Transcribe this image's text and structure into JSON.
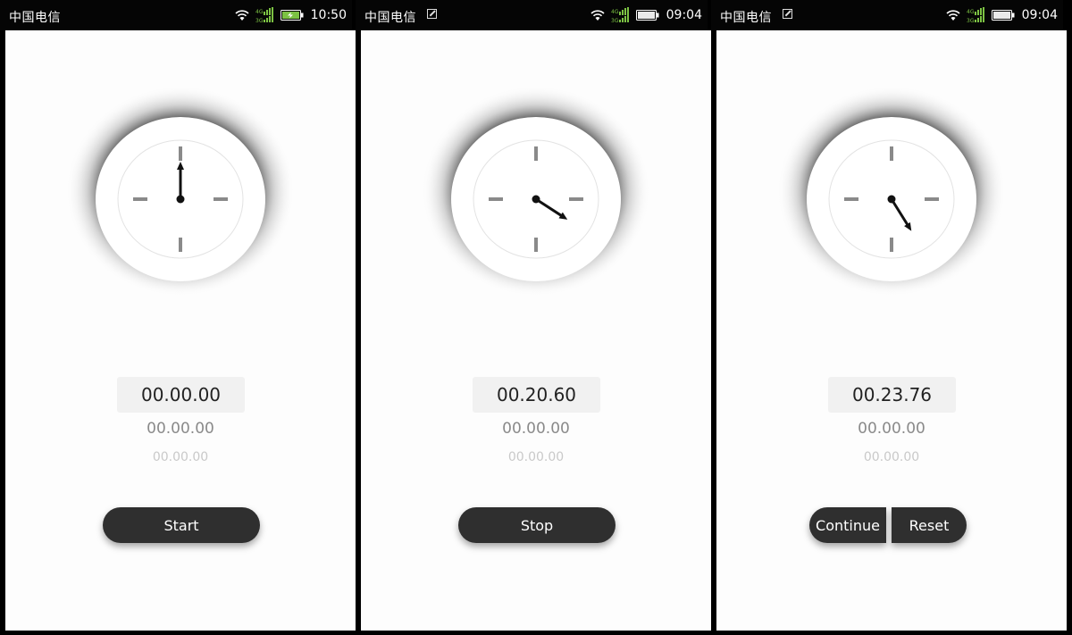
{
  "phones": [
    {
      "status": {
        "carrier": "中国电信",
        "time": "10:50",
        "has_extra_icon": false,
        "battery": "charging"
      },
      "dial": {
        "hand_angle_deg": 0
      },
      "readouts": {
        "main": "00.00.00",
        "second": "00.00.00",
        "third": "00.00.00"
      },
      "buttons": [
        "Start"
      ]
    },
    {
      "status": {
        "carrier": "中国电信",
        "time": "09:04",
        "has_extra_icon": true,
        "battery": "full"
      },
      "dial": {
        "hand_angle_deg": 123
      },
      "readouts": {
        "main": "00.20.60",
        "second": "00.00.00",
        "third": "00.00.00"
      },
      "buttons": [
        "Stop"
      ]
    },
    {
      "status": {
        "carrier": "中国电信",
        "time": "09:04",
        "has_extra_icon": true,
        "battery": "full"
      },
      "dial": {
        "hand_angle_deg": 148
      },
      "readouts": {
        "main": "00.23.76",
        "second": "00.00.00",
        "third": "00.00.00"
      },
      "buttons": [
        "Continue",
        "Reset"
      ]
    }
  ],
  "colors": {
    "statusbar": "#050505",
    "screen": "#fdfdfd",
    "button": "#2f2f2f",
    "tick": "#8a8a8a",
    "hand": "#111111",
    "signal_green": "#7cc243"
  },
  "icons": [
    "wifi-icon",
    "signal-4g-icon",
    "battery-icon",
    "image-notification-icon"
  ]
}
